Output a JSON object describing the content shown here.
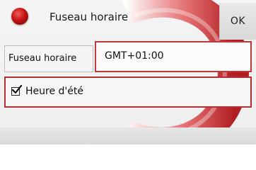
{
  "header": {
    "title": "Fuseau horaire",
    "ok_label": "OK"
  },
  "timezone": {
    "label": "Fuseau horaire",
    "value": "GMT+01:00"
  },
  "daylight_saving": {
    "label": "Heure d'été",
    "checked": true
  },
  "colors": {
    "accent": "#c0393b",
    "logo": "#c41414"
  }
}
